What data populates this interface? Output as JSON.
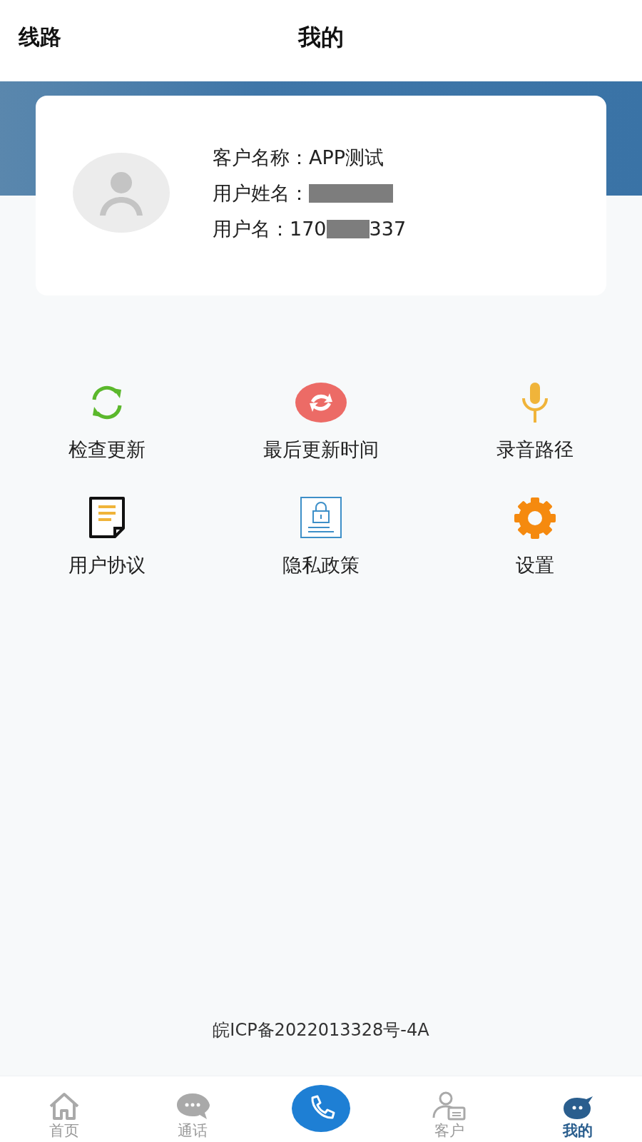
{
  "header": {
    "left_link": "线路",
    "title": "我的"
  },
  "profile": {
    "fields": [
      {
        "label": "客户名称：",
        "value_parts": [
          "APP测试"
        ],
        "redacted": false
      },
      {
        "label": "用户姓名：",
        "redacted": true
      },
      {
        "label": "用户名：",
        "value_parts": [
          "170",
          "337"
        ],
        "redacted": true
      }
    ]
  },
  "menu": [
    {
      "kind": "refresh",
      "label": "检查更新"
    },
    {
      "kind": "sync",
      "label": "最后更新时间"
    },
    {
      "kind": "mic",
      "label": "录音路径"
    },
    {
      "kind": "document",
      "label": "用户协议"
    },
    {
      "kind": "privacy",
      "label": "隐私政策"
    },
    {
      "kind": "settings",
      "label": "设置"
    }
  ],
  "footer_note": "皖ICP备2022013328号-4A",
  "tab_bar": [
    {
      "kind": "home",
      "label": "首页",
      "selected": false
    },
    {
      "kind": "chat",
      "label": "通话",
      "selected": false
    },
    {
      "kind": "call",
      "selected": false
    },
    {
      "kind": "customer",
      "label": "客户",
      "selected": false
    },
    {
      "kind": "mine",
      "label": "我的",
      "selected": true
    }
  ]
}
